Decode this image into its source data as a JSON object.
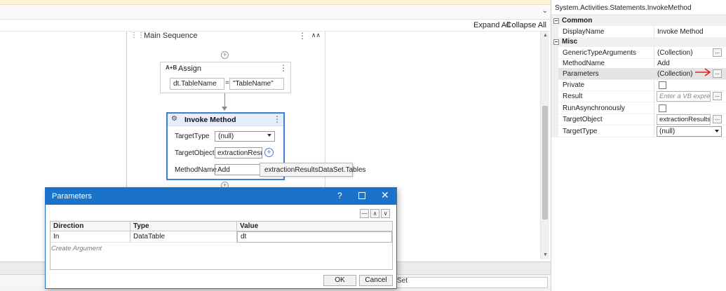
{
  "designer": {
    "expand_all": "Expand All",
    "collapse_all": "Collapse All"
  },
  "sequence": {
    "title": "Main Sequence"
  },
  "assign": {
    "title": "Assign",
    "icon_label": "A+B",
    "left_value": "dt.TableName",
    "operator": "=",
    "right_value": "\"TableName\""
  },
  "invoke": {
    "title": "Invoke Method",
    "target_type_label": "TargetType",
    "target_type_value": "(null)",
    "target_object_label": "TargetObject",
    "target_object_value": "extractionResults",
    "method_name_label": "MethodName",
    "method_name_value": "Add"
  },
  "tooltip": {
    "text": "extractionResultsDataSet.Tables"
  },
  "properties": {
    "title": "System.Activities.Statements.InvokeMethod",
    "categories": [
      "Common",
      "Misc"
    ],
    "rows": [
      {
        "name": "DisplayName",
        "value": "Invoke Method"
      },
      {
        "name": "GenericTypeArguments",
        "value": "(Collection)"
      },
      {
        "name": "MethodName",
        "value": "Add"
      },
      {
        "name": "Parameters",
        "value": "(Collection)"
      },
      {
        "name": "Private",
        "value": ""
      },
      {
        "name": "Result",
        "value": "Enter a VB expression"
      },
      {
        "name": "RunAsynchronously",
        "value": ""
      },
      {
        "name": "TargetObject",
        "value": "extractionResultsDataSet.Tables"
      },
      {
        "name": "TargetType",
        "value": "(null)"
      }
    ],
    "ellipsis": "..."
  },
  "dialog": {
    "title": "Parameters",
    "help": "?",
    "columns": [
      "Direction",
      "Type",
      "Value"
    ],
    "rows": [
      {
        "direction": "In",
        "type": "DataTable",
        "value": "dt"
      }
    ],
    "create_argument": "Create Argument",
    "ok": "OK",
    "cancel": "Cancel"
  },
  "bottom": {
    "partial_text": "Set"
  },
  "colors": {
    "accent": "#1a73c9",
    "selection_border": "#3b7fd6",
    "annotation_arrow": "#e02020"
  }
}
